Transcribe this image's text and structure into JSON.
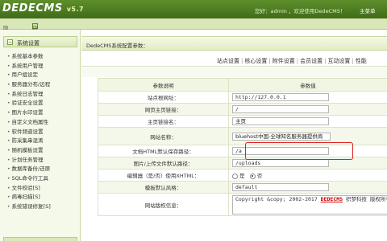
{
  "header": {
    "logo_text": "DEDECMS",
    "logo_version": "v5.7",
    "greeting": "您好：admin ，欢迎使用DedeCMS！",
    "main_menu": "主菜单"
  },
  "subbar": {
    "hide_menu": "隐藏菜单",
    "feature_map": "功能地图"
  },
  "sidebar": {
    "section_title": "系统设置",
    "items": [
      "系统基本参数",
      "系统用户管理",
      "用户组设定",
      "服务器分布/远程",
      "系统日志管理",
      "验证安全设置",
      "图片水印设置",
      "自定义文档属性",
      "软件频道设置",
      "防采集串混淆",
      "随机模板设置",
      "计划任务管理",
      "数据库备份/还原",
      "SQL命令行工具",
      "文件校验[S]",
      "病毒扫描[S]",
      "系统错误修复[S]"
    ]
  },
  "page": {
    "title": "DedeCMS系统配置参数：",
    "tabs": [
      "站点设置",
      "核心设置",
      "附件设置",
      "会员设置",
      "互动设置",
      "性能"
    ],
    "col_param": "参数说明",
    "col_value": "参数值"
  },
  "rows": [
    {
      "label": "站点根网址：",
      "value": "http://127.0.0.1"
    },
    {
      "label": "网页主页链接：",
      "value": "/"
    },
    {
      "label": "主页链接名：",
      "value": "主页"
    },
    {
      "label": "网站名称：",
      "value": "bluehost中国-全球知名服务器提供商"
    },
    {
      "label": "文档HTML默认保存路径：",
      "value": "/a"
    },
    {
      "label": "图片/上传文件默认路径：",
      "value": "/uploads"
    },
    {
      "label": "编辑器（是/否）使用XHTML：",
      "option_yes": "是",
      "option_no": "否",
      "selected": "否"
    },
    {
      "label": "模板默认风格：",
      "value": "default"
    },
    {
      "label": "网站版权信息：",
      "value_prefix": "Copyright &copy; 2002-2017 ",
      "value_link": "DEDECMS",
      "value_suffix": " 织梦科技 版权所有"
    }
  ],
  "colors": {
    "header_green": "#4a7a20",
    "highlight_box": "#e02020"
  }
}
